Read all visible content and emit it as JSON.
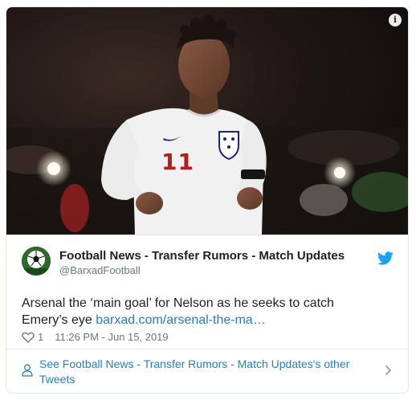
{
  "media": {
    "jersey_number": "11",
    "info_icon": "info-icon",
    "info_glyph": "i"
  },
  "tweet": {
    "author_name": "Football News - Transfer Rumors - Match Updates",
    "author_handle": "@BarxadFootball",
    "text_line1": "Arsenal the ‘main goal’ for Nelson as he seeks to catch",
    "text_line2_prefix": "Emery’s eye ",
    "link_text": "barxad.com/arsenal-the-ma…",
    "like_count": "1",
    "timestamp": "11:26 PM - Jun 15, 2019",
    "brand_color": "#1da1f2",
    "link_color": "#2b7bb9"
  },
  "footer": {
    "link_text": "See Football News - Transfer Rumors - Match Updates's other Tweets"
  }
}
